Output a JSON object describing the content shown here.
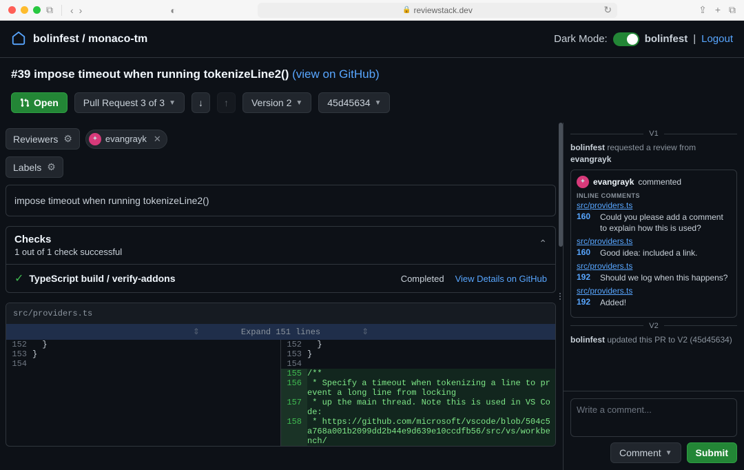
{
  "browser": {
    "domain": "reviewstack.dev"
  },
  "header": {
    "repo": "bolinfest / monaco-tm",
    "dark_mode_label": "Dark Mode:",
    "username": "bolinfest",
    "logout": "Logout"
  },
  "pr": {
    "number": "#39",
    "title": "impose timeout when running tokenizeLine2()",
    "view_link": "(view on GitHub)"
  },
  "toolbar": {
    "status": "Open",
    "pr_nav": "Pull Request 3 of 3",
    "version": "Version 2",
    "commit": "45d45634"
  },
  "reviewers": {
    "label": "Reviewers",
    "items": [
      "evangrayk"
    ]
  },
  "labels": {
    "label": "Labels"
  },
  "description": "impose timeout when running tokenizeLine2()",
  "checks": {
    "title": "Checks",
    "summary": "1 out of 1 check successful",
    "items": [
      {
        "name": "TypeScript build / verify-addons",
        "status": "Completed",
        "link": "View Details on GitHub"
      }
    ]
  },
  "diff": {
    "file": "src/providers.ts",
    "expand": "Expand 151 lines",
    "left": [
      {
        "n": "152",
        "t": "  }"
      },
      {
        "n": "153",
        "t": "}"
      },
      {
        "n": "154",
        "t": ""
      }
    ],
    "right": [
      {
        "n": "152",
        "t": "  }",
        "add": false
      },
      {
        "n": "153",
        "t": "}",
        "add": false
      },
      {
        "n": "154",
        "t": "",
        "add": false
      },
      {
        "n": "155",
        "t": "/**",
        "add": true
      },
      {
        "n": "156",
        "t": " * Specify a timeout when tokenizing a line to prevent a long line from locking",
        "add": true
      },
      {
        "n": "157",
        "t": " * up the main thread. Note this is used in VS Code:",
        "add": true
      },
      {
        "n": "158",
        "t": " * https://github.com/microsoft/vscode/blob/504c5a768a001b2099dd2b44e9d639e10ccdfb56/src/vs/workbench/",
        "add": true
      }
    ]
  },
  "timeline": {
    "v1_label": "V1",
    "v2_label": "V2",
    "request_event": {
      "who": "bolinfest",
      "text": "requested a review from",
      "whom": "evangrayk"
    },
    "comment_block": {
      "author": "evangrayk",
      "verb": "commented",
      "inline_label": "INLINE COMMENTS",
      "items": [
        {
          "file": "src/providers.ts",
          "line": "160",
          "text": "Could you please add a comment to explain how this is used?"
        },
        {
          "file": "src/providers.ts",
          "line": "160",
          "text": "Good idea: included a link."
        },
        {
          "file": "src/providers.ts",
          "line": "192",
          "text": "Should we log when this happens?"
        },
        {
          "file": "src/providers.ts",
          "line": "192",
          "text": "Added!"
        }
      ]
    },
    "update_event": {
      "who": "bolinfest",
      "text": "updated this PR to V2 (45d45634)"
    }
  },
  "compose": {
    "placeholder": "Write a comment...",
    "comment_btn": "Comment",
    "submit_btn": "Submit"
  }
}
